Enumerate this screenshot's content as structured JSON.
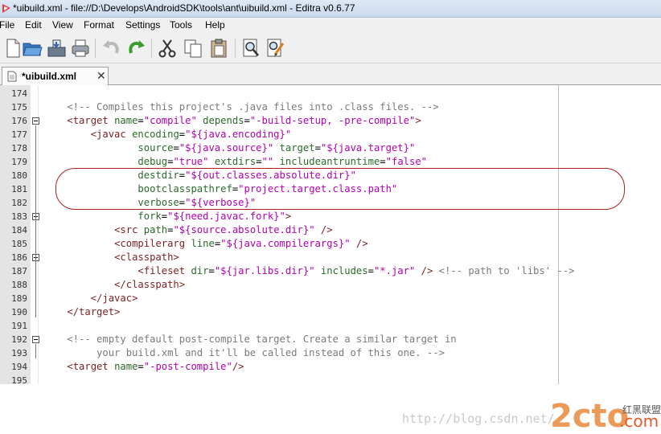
{
  "window": {
    "title": "*uibuild.xml - file://D:\\Develops\\AndroidSDK\\tools\\ant\\uibuild.xml - Editra v0.6.77"
  },
  "menu": [
    "File",
    "Edit",
    "View",
    "Format",
    "Settings",
    "Tools",
    "Help"
  ],
  "toolbar": {
    "buttons": [
      "new-document-icon",
      "open-folder-icon",
      "save-icon",
      "print-icon",
      "undo-icon",
      "redo-icon",
      "cut-icon",
      "copy-icon",
      "paste-icon",
      "find-icon",
      "find-replace-icon"
    ]
  },
  "tab": {
    "label": "*uibuild.xml",
    "close": "✕"
  },
  "colors": {
    "comment": "#7a7a7a",
    "tag": "#7b1f1f",
    "attribute": "#2a6a2a",
    "string": "#b000b0",
    "annotation": "#b21e1e"
  },
  "lines": [
    {
      "n": "174",
      "fold": false,
      "tokens": []
    },
    {
      "n": "175",
      "fold": false,
      "tokens": [
        [
          "c",
          "    <!-- Compiles this project's .java files into .class files. -->"
        ]
      ]
    },
    {
      "n": "176",
      "fold": true,
      "tokens": [
        [
          "p",
          "    "
        ],
        [
          "t",
          "<target "
        ],
        [
          "a",
          "name"
        ],
        [
          "e",
          "="
        ],
        [
          "s",
          "\"compile\" "
        ],
        [
          "a",
          "depends"
        ],
        [
          "e",
          "="
        ],
        [
          "s",
          "\"-build-setup, -pre-compile\""
        ],
        [
          "t",
          ">"
        ]
      ]
    },
    {
      "n": "177",
      "fold": false,
      "tokens": [
        [
          "p",
          "        "
        ],
        [
          "t",
          "<javac "
        ],
        [
          "a",
          "encoding"
        ],
        [
          "e",
          "="
        ],
        [
          "s",
          "\"${java.encoding}\""
        ]
      ]
    },
    {
      "n": "178",
      "fold": false,
      "tokens": [
        [
          "p",
          "                "
        ],
        [
          "a",
          "source"
        ],
        [
          "e",
          "="
        ],
        [
          "s",
          "\"${java.source}\" "
        ],
        [
          "a",
          "target"
        ],
        [
          "e",
          "="
        ],
        [
          "s",
          "\"${java.target}\""
        ]
      ]
    },
    {
      "n": "179",
      "fold": false,
      "tokens": [
        [
          "p",
          "                "
        ],
        [
          "a",
          "debug"
        ],
        [
          "e",
          "="
        ],
        [
          "s",
          "\"true\" "
        ],
        [
          "a",
          "extdirs"
        ],
        [
          "e",
          "="
        ],
        [
          "s",
          "\"\" "
        ],
        [
          "a",
          "includeantruntime"
        ],
        [
          "e",
          "="
        ],
        [
          "s",
          "\"false\""
        ]
      ]
    },
    {
      "n": "180",
      "fold": false,
      "tokens": [
        [
          "p",
          "                "
        ],
        [
          "a",
          "destdir"
        ],
        [
          "e",
          "="
        ],
        [
          "s",
          "\"${out.classes.absolute.dir}\""
        ]
      ]
    },
    {
      "n": "181",
      "fold": false,
      "tokens": [
        [
          "p",
          "                "
        ],
        [
          "a",
          "bootclasspathref"
        ],
        [
          "e",
          "="
        ],
        [
          "s",
          "\"project.target.class.path\""
        ]
      ]
    },
    {
      "n": "182",
      "fold": false,
      "tokens": [
        [
          "p",
          "                "
        ],
        [
          "a",
          "verbose"
        ],
        [
          "e",
          "="
        ],
        [
          "s",
          "\"${verbose}\""
        ]
      ]
    },
    {
      "n": "183",
      "fold": true,
      "tokens": [
        [
          "p",
          "                "
        ],
        [
          "a",
          "fork"
        ],
        [
          "e",
          "="
        ],
        [
          "s",
          "\"${need.javac.fork}\""
        ],
        [
          "t",
          ">"
        ]
      ]
    },
    {
      "n": "184",
      "fold": false,
      "tokens": [
        [
          "p",
          "            "
        ],
        [
          "t",
          "<src "
        ],
        [
          "a",
          "path"
        ],
        [
          "e",
          "="
        ],
        [
          "s",
          "\"${source.absolute.dir}\" "
        ],
        [
          "t",
          "/>"
        ]
      ]
    },
    {
      "n": "185",
      "fold": false,
      "tokens": [
        [
          "p",
          "            "
        ],
        [
          "t",
          "<compilerarg "
        ],
        [
          "a",
          "line"
        ],
        [
          "e",
          "="
        ],
        [
          "s",
          "\"${java.compilerargs}\" "
        ],
        [
          "t",
          "/>"
        ]
      ]
    },
    {
      "n": "186",
      "fold": true,
      "tokens": [
        [
          "p",
          "            "
        ],
        [
          "t",
          "<classpath>"
        ]
      ]
    },
    {
      "n": "187",
      "fold": false,
      "tokens": [
        [
          "p",
          "                "
        ],
        [
          "t",
          "<fileset "
        ],
        [
          "a",
          "dir"
        ],
        [
          "e",
          "="
        ],
        [
          "s",
          "\"${jar.libs.dir}\" "
        ],
        [
          "a",
          "includes"
        ],
        [
          "e",
          "="
        ],
        [
          "s",
          "\"*.jar\" "
        ],
        [
          "t",
          "/> "
        ],
        [
          "c",
          "<!-- path to 'libs' -->"
        ]
      ]
    },
    {
      "n": "188",
      "fold": false,
      "tokens": [
        [
          "p",
          "            "
        ],
        [
          "t",
          "</classpath>"
        ]
      ]
    },
    {
      "n": "189",
      "fold": false,
      "tokens": [
        [
          "p",
          "        "
        ],
        [
          "t",
          "</javac>"
        ]
      ]
    },
    {
      "n": "190",
      "fold": false,
      "tokens": [
        [
          "p",
          "    "
        ],
        [
          "t",
          "</target>"
        ]
      ]
    },
    {
      "n": "191",
      "fold": false,
      "tokens": []
    },
    {
      "n": "192",
      "fold": true,
      "tokens": [
        [
          "c",
          "    <!-- empty default post-compile target. Create a similar target in"
        ]
      ]
    },
    {
      "n": "193",
      "fold": false,
      "tokens": [
        [
          "c",
          "         your build.xml and it'll be called instead of this one. -->"
        ]
      ]
    },
    {
      "n": "194",
      "fold": false,
      "tokens": [
        [
          "p",
          "    "
        ],
        [
          "t",
          "<target "
        ],
        [
          "a",
          "name"
        ],
        [
          "e",
          "="
        ],
        [
          "s",
          "\"-post-compile\""
        ],
        [
          "t",
          "/>"
        ]
      ]
    },
    {
      "n": "195",
      "fold": false,
      "tokens": []
    }
  ],
  "watermark": "http://blog.csdn.net/",
  "logo": {
    "main": "2cto",
    "suffix": ".com",
    "chinese": "红黑联盟"
  }
}
